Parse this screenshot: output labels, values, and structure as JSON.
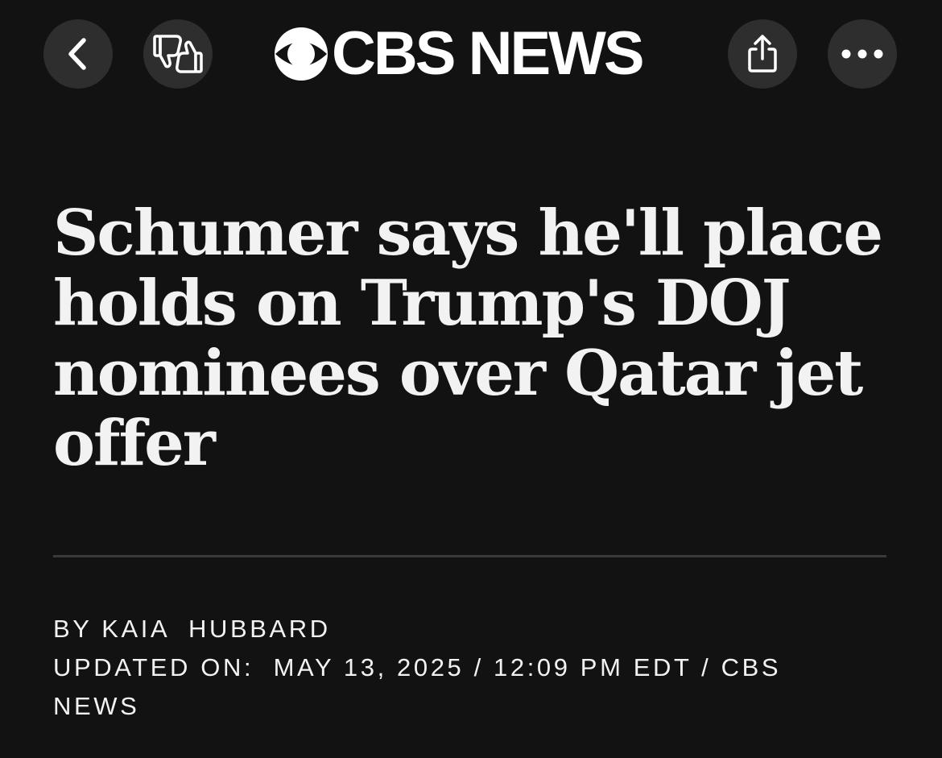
{
  "header": {
    "logo_text": "CBS NEWS",
    "back_icon": "chevron-left-icon",
    "feedback_icon": "thumbs-up-down-icon",
    "share_icon": "share-icon",
    "more_icon": "ellipsis-icon"
  },
  "article": {
    "headline": "Schumer says he'll place holds on Trump's DOJ nominees over Qatar jet offer",
    "byline": "BY KAIA  HUBBARD",
    "updated": "UPDATED ON:  MAY 13, 2025 / 12:09 PM EDT / CBS NEWS"
  },
  "colors": {
    "background": "#121212",
    "button_bg": "#2e2e2f",
    "text": "#f2f2f2",
    "divider": "#3a3a3b"
  }
}
